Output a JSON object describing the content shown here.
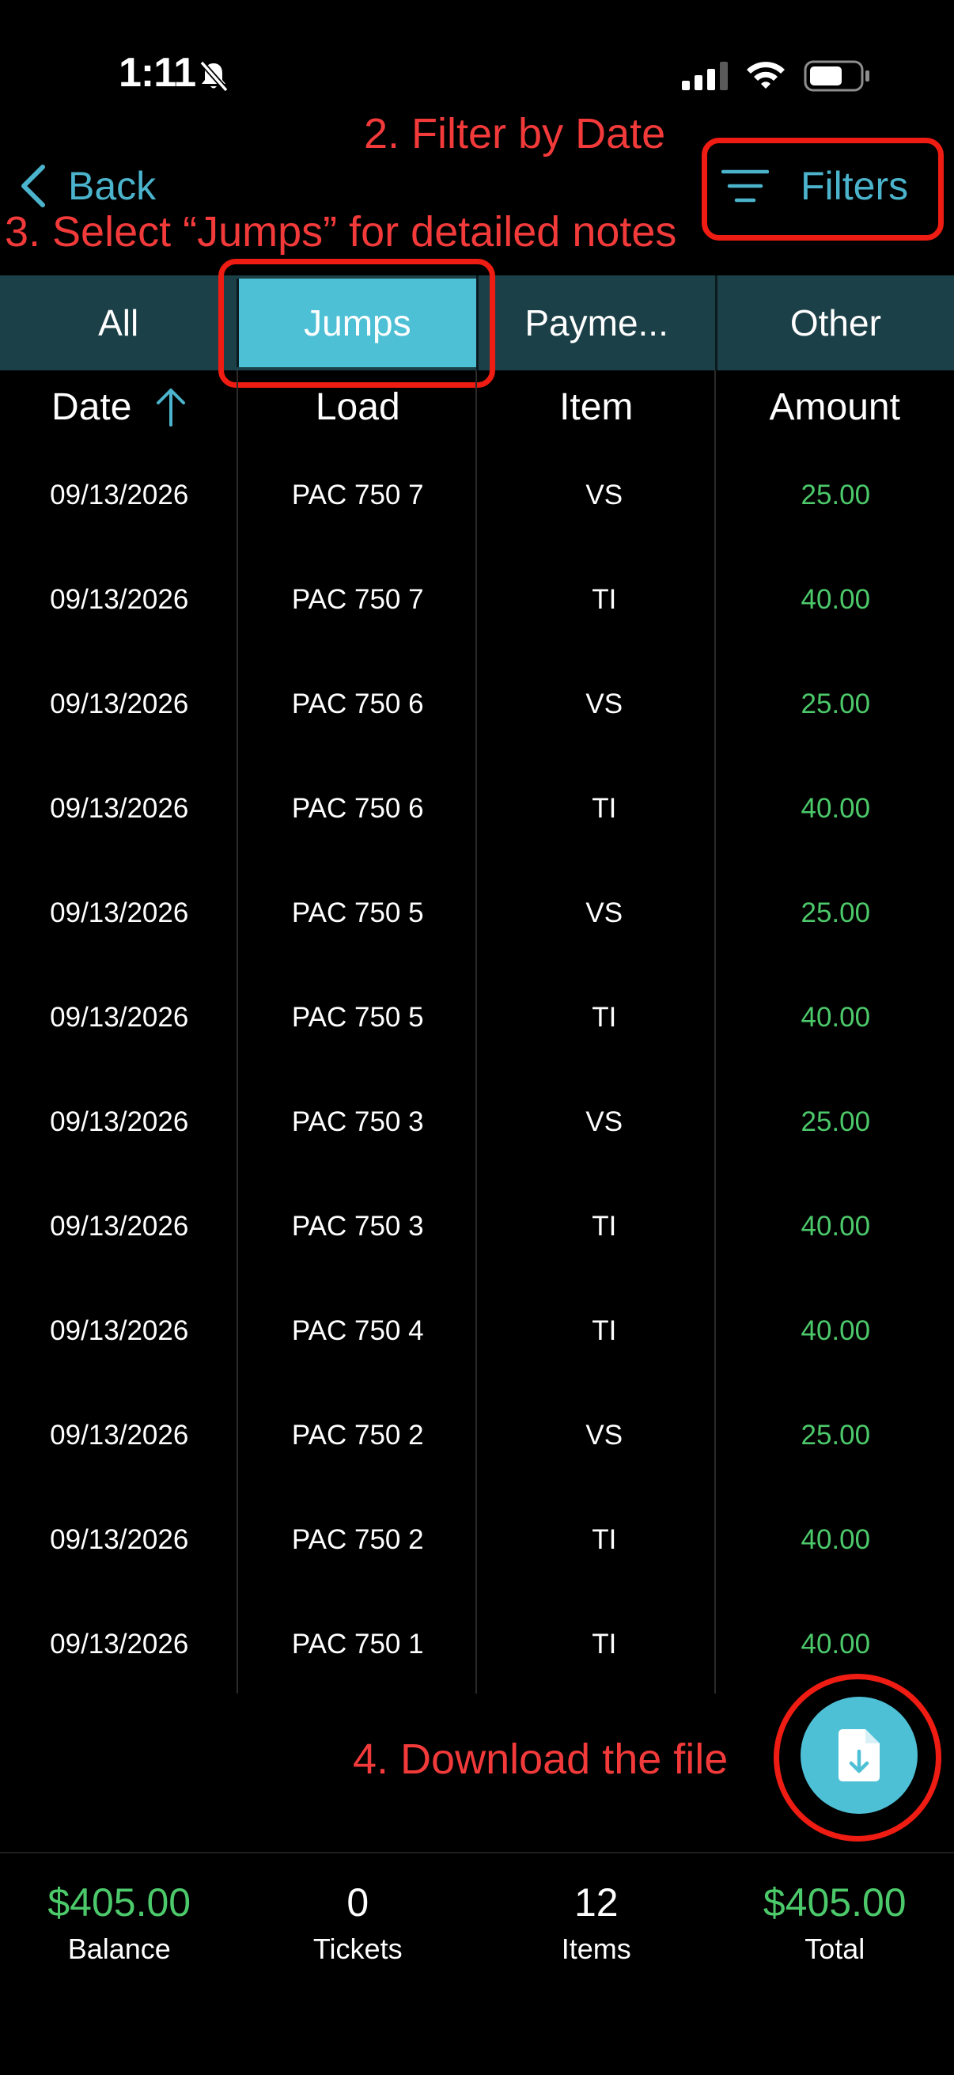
{
  "status_bar": {
    "time": "1:11"
  },
  "nav": {
    "back_label": "Back",
    "filters_label": "Filters"
  },
  "annotations": {
    "filter_by_date": "2. Filter by Date",
    "select_jumps": "3. Select “Jumps” for detailed notes",
    "download_file": "4. Download the file"
  },
  "tabs": [
    {
      "label": "All",
      "active": false
    },
    {
      "label": "Jumps",
      "active": true
    },
    {
      "label": "Payme...",
      "active": false
    },
    {
      "label": "Other",
      "active": false
    }
  ],
  "table": {
    "headers": [
      "Date",
      "Load",
      "Item",
      "Amount"
    ],
    "sort_column": "Date",
    "sort_direction": "ascending",
    "rows": [
      [
        "09/13/2026",
        "PAC 750 7",
        "VS",
        "25.00"
      ],
      [
        "09/13/2026",
        "PAC 750 7",
        "TI",
        "40.00"
      ],
      [
        "09/13/2026",
        "PAC 750 6",
        "VS",
        "25.00"
      ],
      [
        "09/13/2026",
        "PAC 750 6",
        "TI",
        "40.00"
      ],
      [
        "09/13/2026",
        "PAC 750 5",
        "VS",
        "25.00"
      ],
      [
        "09/13/2026",
        "PAC 750 5",
        "TI",
        "40.00"
      ],
      [
        "09/13/2026",
        "PAC 750 3",
        "VS",
        "25.00"
      ],
      [
        "09/13/2026",
        "PAC 750 3",
        "TI",
        "40.00"
      ],
      [
        "09/13/2026",
        "PAC 750 4",
        "TI",
        "40.00"
      ],
      [
        "09/13/2026",
        "PAC 750 2",
        "VS",
        "25.00"
      ],
      [
        "09/13/2026",
        "PAC 750 2",
        "TI",
        "40.00"
      ],
      [
        "09/13/2026",
        "PAC 750 1",
        "TI",
        "40.00"
      ]
    ]
  },
  "footer": {
    "balance": {
      "value": "$405.00",
      "label": "Balance"
    },
    "tickets": {
      "value": "0",
      "label": "Tickets"
    },
    "items": {
      "value": "12",
      "label": "Items"
    },
    "total": {
      "value": "$405.00",
      "label": "Total"
    }
  },
  "icons": {
    "bell": "bell-slash-icon",
    "signal": "cellular-signal-icon",
    "wifi": "wifi-icon",
    "battery": "battery-icon",
    "back": "chevron-left-icon",
    "filters": "filter-lines-icon",
    "sort": "arrow-up-icon",
    "fab": "document-download-icon"
  },
  "colors": {
    "accent": "#4ec0d6",
    "link": "#4bb4cc",
    "tabbar": "#1c4048",
    "amount": "#4cc96a",
    "annotation": "#f23a3a",
    "annotation_box": "#ee1c12"
  }
}
